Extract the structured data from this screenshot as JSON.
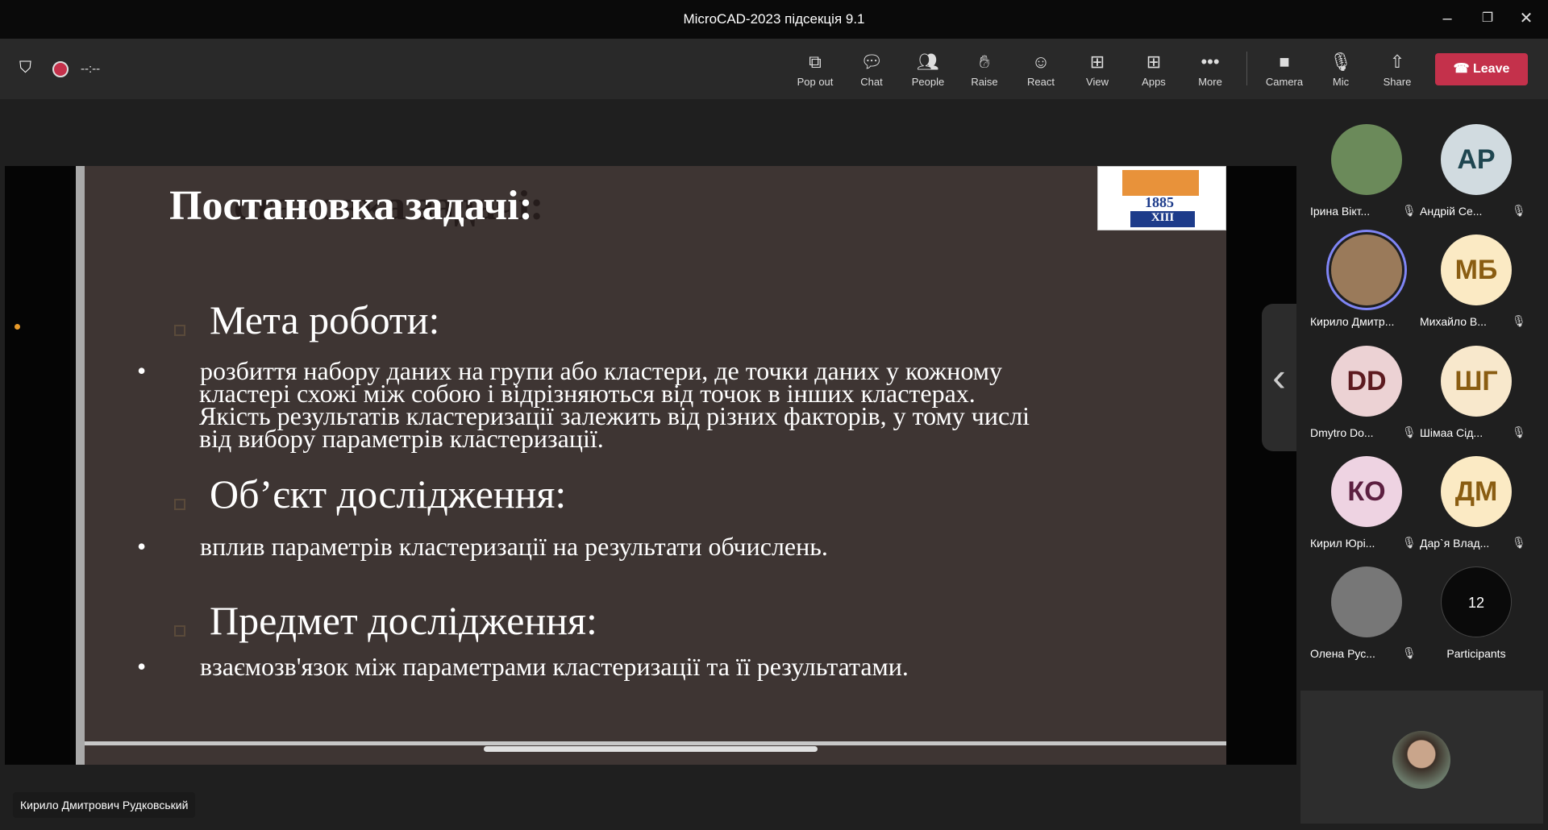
{
  "window": {
    "title": "MicroCAD-2023 підсекція 9.1"
  },
  "toolbar": {
    "timer": "--:--",
    "items": [
      {
        "label": "Pop out",
        "icon": "pop-out-icon"
      },
      {
        "label": "Chat",
        "icon": "chat-icon"
      },
      {
        "label": "People",
        "icon": "people-icon"
      },
      {
        "label": "Raise",
        "icon": "raise-hand-icon"
      },
      {
        "label": "React",
        "icon": "smile-icon"
      },
      {
        "label": "View",
        "icon": "grid-icon"
      },
      {
        "label": "Apps",
        "icon": "add-app-icon"
      },
      {
        "label": "More",
        "icon": "more-icon"
      },
      {
        "label": "Camera",
        "icon": "camera-off-icon"
      },
      {
        "label": "Mic",
        "icon": "mic-off-icon"
      },
      {
        "label": "Share",
        "icon": "share-icon"
      }
    ],
    "leave": "Leave"
  },
  "slide": {
    "title": "Постановка задачі:",
    "logo": {
      "year": "1885",
      "roman": "XIII"
    },
    "sections": [
      {
        "heading": "Мета роботи:",
        "lines": [
          "розбиття набору даних на групи або кластери, де точки даних у кожному",
          "кластері схожі між собою і відрізняються від точок в інших кластерах.",
          "Якість результатів кластеризації залежить від різних факторів, у тому числі",
          "від вибору параметрів кластеризації."
        ]
      },
      {
        "heading": "Об’єкт дослідження:",
        "lines": [
          "вплив параметрів кластеризації на результати обчислень."
        ]
      },
      {
        "heading": "Предмет дослідження:",
        "lines": [
          "взаємозв'язок між параметрами кластеризації та її результатами."
        ]
      }
    ]
  },
  "presenter_name": "Кирило Дмитрович Рудковський",
  "participants": [
    {
      "name": "Ірина Вікт...",
      "initials": "",
      "bg": "#6b8a5a",
      "fg": "#fff"
    },
    {
      "name": "Андрій Се...",
      "initials": "AP",
      "bg": "#d1dbe0",
      "fg": "#1f4650"
    },
    {
      "name": "Кирило Дмитр...",
      "initials": "",
      "bg": "#9a7a5a",
      "fg": "#fff"
    },
    {
      "name": "Михайло В...",
      "initials": "МБ",
      "bg": "#fbeac4",
      "fg": "#8a5d12"
    },
    {
      "name": "Dmytro Do...",
      "initials": "DD",
      "bg": "#ecd2d4",
      "fg": "#5c1a1f"
    },
    {
      "name": "Шімаа Сід...",
      "initials": "ШГ",
      "bg": "#f8e8cc",
      "fg": "#8a5d12"
    },
    {
      "name": "Кирил Юрі...",
      "initials": "КО",
      "bg": "#eed3e2",
      "fg": "#5c1f40"
    },
    {
      "name": "Дар`я Влад...",
      "initials": "ДМ",
      "bg": "#fbeac4",
      "fg": "#8a5d12"
    },
    {
      "name": "Олена Рус...",
      "initials": "",
      "bg": "#777",
      "fg": "#fff"
    }
  ],
  "participants_count": {
    "count": "12",
    "label": "Participants"
  }
}
